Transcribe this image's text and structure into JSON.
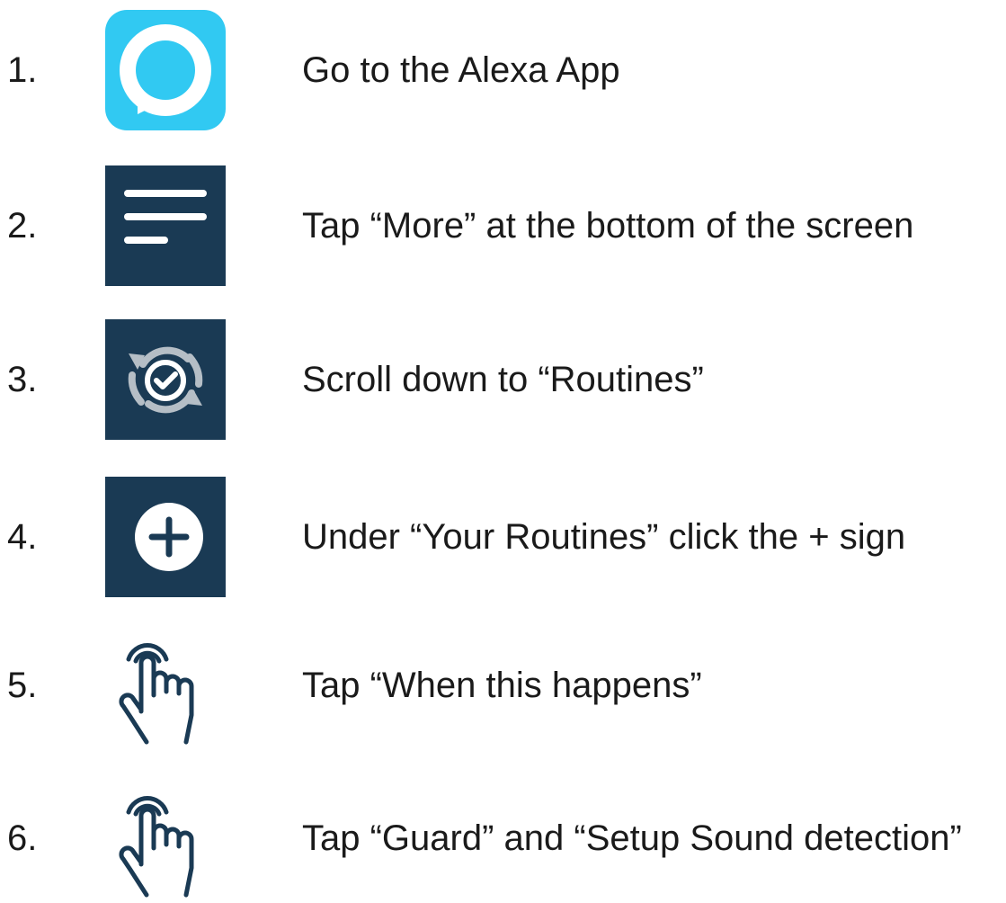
{
  "steps": [
    {
      "number": "1.",
      "icon": "alexa-app-icon",
      "text": "Go to the Alexa App"
    },
    {
      "number": "2.",
      "icon": "menu-more-icon",
      "text": "Tap “More” at the bottom of the screen"
    },
    {
      "number": "3.",
      "icon": "routines-icon",
      "text": "Scroll down to “Routines”"
    },
    {
      "number": "4.",
      "icon": "plus-circle-icon",
      "text": "Under “Your Routines” click the + sign"
    },
    {
      "number": "5.",
      "icon": "tap-hand-icon",
      "text": "Tap “When this happens”"
    },
    {
      "number": "6.",
      "icon": "tap-hand-icon",
      "text": "Tap “Guard” and “Setup Sound detection”"
    }
  ],
  "colors": {
    "alexa_blue": "#31C9F2",
    "navy_tile": "#1A3A54",
    "text": "#1A1A1A",
    "routines_gray": "#B5BEC6"
  }
}
